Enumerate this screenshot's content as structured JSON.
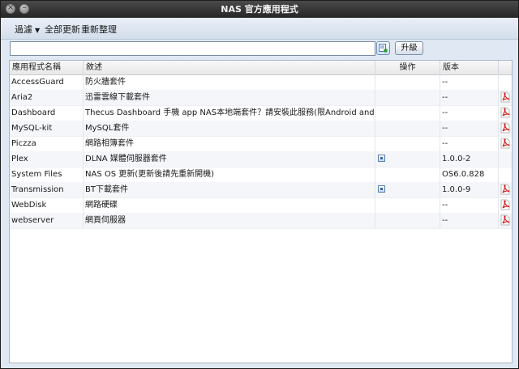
{
  "window": {
    "title": "NAS 官方應用程式",
    "close_glyph": "×",
    "minimize_glyph": "–"
  },
  "toolbar": {
    "filter_label": "過濾",
    "update_all_label": "全部更新",
    "reorganize_label": "重新整理"
  },
  "search": {
    "value": "",
    "placeholder": "",
    "upgrade_label": "升級"
  },
  "table": {
    "columns": [
      "應用程式名稱",
      "敘述",
      "操作",
      "版本"
    ],
    "rows": [
      {
        "name": "AccessGuard",
        "desc": "防火牆套件",
        "has_action": false,
        "version": "--",
        "has_pdf": false
      },
      {
        "name": "Aria2",
        "desc": "迅雷雲線下載套件",
        "has_action": false,
        "version": "--",
        "has_pdf": true
      },
      {
        "name": "Dashboard",
        "desc": "Thecus Dashboard 手機 app NAS本地端套件？請安裝此服務(限Android and iOS...",
        "has_action": false,
        "version": "--",
        "has_pdf": true
      },
      {
        "name": "MySQL-kit",
        "desc": "MySQL套件",
        "has_action": false,
        "version": "--",
        "has_pdf": true
      },
      {
        "name": "Piczza",
        "desc": "網路相簿套件",
        "has_action": false,
        "version": "--",
        "has_pdf": true
      },
      {
        "name": "Plex",
        "desc": "DLNA 媒體伺服器套件",
        "has_action": true,
        "version": "1.0.0-2",
        "has_pdf": false
      },
      {
        "name": "System Files",
        "desc": "NAS OS 更新(更新後請先重新開機)",
        "has_action": false,
        "version": "OS6.0.828",
        "has_pdf": false
      },
      {
        "name": "Transmission",
        "desc": "BT下載套件",
        "has_action": true,
        "version": "1.0.0-9",
        "has_pdf": true
      },
      {
        "name": "WebDisk",
        "desc": "網路硬碟",
        "has_action": false,
        "version": "--",
        "has_pdf": true
      },
      {
        "name": "webserver",
        "desc": "網頁伺服器",
        "has_action": false,
        "version": "--",
        "has_pdf": true
      }
    ]
  },
  "colors": {
    "titlebar": "#333333",
    "panel": "#dfe8f3",
    "pdf_red": "#d21d1d"
  },
  "icons": {
    "action": "checkbox-icon",
    "doc": "pdf-icon",
    "search": "search-go-icon"
  }
}
